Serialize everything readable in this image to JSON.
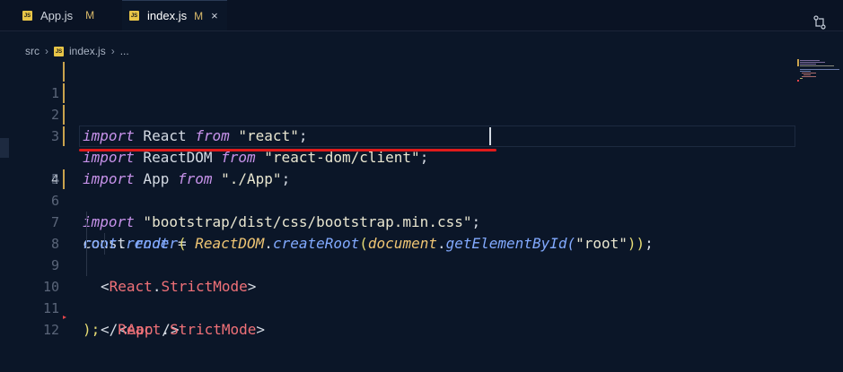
{
  "tabs": [
    {
      "icon": "JS",
      "name": "App.js",
      "status": "M",
      "active": false
    },
    {
      "icon": "JS",
      "name": "index.js",
      "status": "M",
      "active": true,
      "close": "×"
    }
  ],
  "breadcrumb": {
    "folder": "src",
    "icon": "JS",
    "file": "index.js",
    "more": "..."
  },
  "editor": {
    "current_line": 4,
    "lines": [
      {
        "n": "1"
      },
      {
        "n": "2"
      },
      {
        "n": "3"
      },
      {
        "n": "4"
      },
      {
        "n": "5"
      },
      {
        "n": "6"
      },
      {
        "n": "7"
      },
      {
        "n": "8"
      },
      {
        "n": "9"
      },
      {
        "n": "10"
      },
      {
        "n": "11"
      },
      {
        "n": "12"
      }
    ],
    "code": {
      "l1": [
        "import",
        " React ",
        "from",
        " \"react\"",
        ";"
      ],
      "l2": [
        "import",
        " ReactDOM ",
        "from",
        " \"react-dom/client\"",
        ";"
      ],
      "l3": [
        "import",
        " App ",
        "from",
        " \"./App\"",
        ";"
      ],
      "l4": [
        "import",
        " \"bootstrap/dist/css/bootstrap.min.css\"",
        ";"
      ],
      "l6": [
        "const ",
        "root",
        " = ",
        "ReactDOM",
        ".",
        "createRoot",
        "(",
        "document",
        ".",
        "getElementById",
        "(",
        "\"root\"",
        "))",
        ";"
      ],
      "l7": [
        "root",
        ".",
        "render",
        "("
      ],
      "l8": [
        "<",
        "React",
        ".",
        "StrictMode",
        ">"
      ],
      "l9": [
        "<",
        "App",
        " />"
      ],
      "l10": [
        "</",
        "React",
        ".",
        "StrictMode",
        ">"
      ],
      "l11": [
        ");"
      ]
    }
  },
  "colors": {
    "background": "#0b1628",
    "keyword": "#c792ea",
    "function": "#82aaff",
    "tag": "#f07178",
    "annotation_underline": "#e01b1b",
    "modified_marker": "#c9a24d"
  },
  "icons": {
    "compare": "compare-changes-icon"
  }
}
